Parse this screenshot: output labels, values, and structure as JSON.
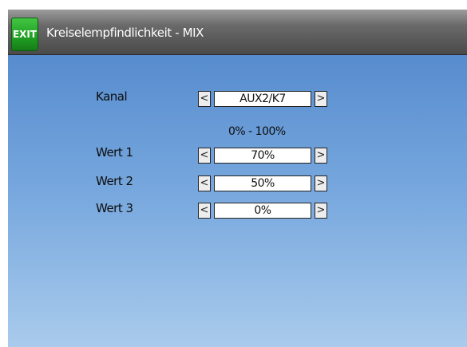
{
  "header": {
    "exit_label": "EXIT",
    "title": "Kreiselempfindlichkeit - MIX"
  },
  "form": {
    "channel": {
      "label": "Kanal",
      "value": "AUX2/K7"
    },
    "range_text": "0% - 100%",
    "values": [
      {
        "label": "Wert 1",
        "value": "70%"
      },
      {
        "label": "Wert 2",
        "value": "50%"
      },
      {
        "label": "Wert 3",
        "value": "0%"
      }
    ]
  },
  "icons": {
    "left": "chevron-left-icon",
    "right": "chevron-right-icon"
  },
  "colors": {
    "exit_green": "#1f9f22",
    "header_gray": "#4a4a4a",
    "background_blue": "#5a8fd0"
  }
}
